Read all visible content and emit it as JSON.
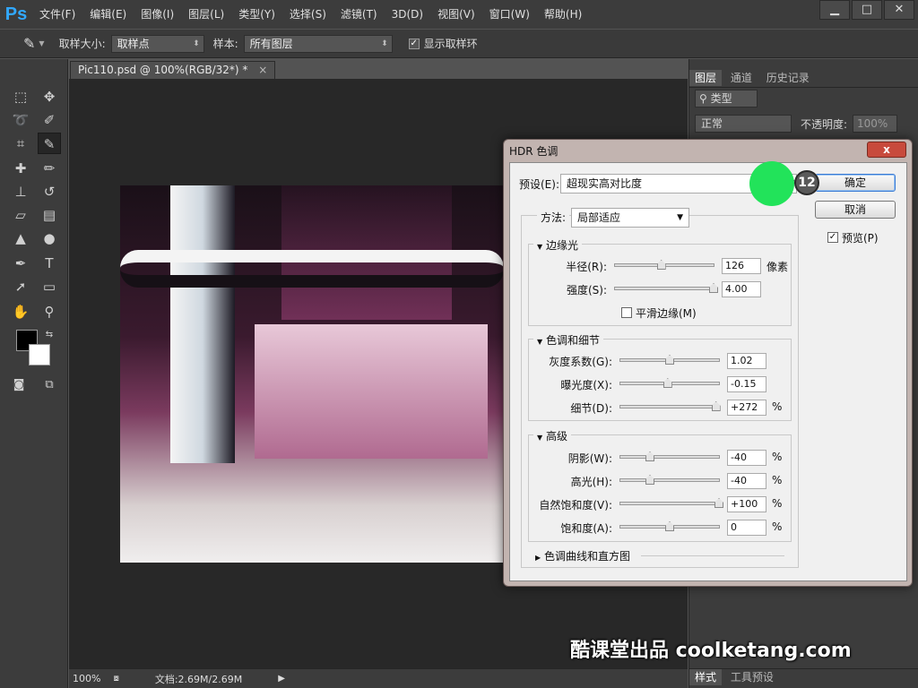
{
  "app": {
    "logo": "Ps"
  },
  "menu": [
    "文件(F)",
    "编辑(E)",
    "图像(I)",
    "图层(L)",
    "类型(Y)",
    "选择(S)",
    "滤镜(T)",
    "3D(D)",
    "视图(V)",
    "窗口(W)",
    "帮助(H)"
  ],
  "window_controls": {
    "minimize": "▁",
    "maximize": "□",
    "close": "✕"
  },
  "options": {
    "sample_size_label": "取样大小:",
    "sample_size_value": "取样点",
    "sample_label": "样本:",
    "sample_value": "所有图层",
    "show_ring_label": "显示取样环",
    "show_ring_checked": true
  },
  "document": {
    "tab_title": "Pic110.psd @ 100%(RGB/32*) *",
    "tab_close": "×",
    "zoom": "100%",
    "doc_info": "文档:2.69M/2.69M"
  },
  "panel": {
    "tabs": [
      "图层",
      "通道",
      "历史记录"
    ],
    "kind_label": "类型",
    "blend_mode": "正常",
    "opacity_label": "不透明度:",
    "opacity_value": "100%",
    "bottom_tabs": [
      "样式",
      "工具预设"
    ]
  },
  "dialog": {
    "title": "HDR 色调",
    "close_label": "x",
    "preset_label": "预设(E):",
    "preset_value": "超现实高对比度",
    "ok": "确定",
    "cancel": "取消",
    "preview_label": "预览(P)",
    "preview_checked": true,
    "method_label": "方法:",
    "method_value": "局部适应",
    "edge_glow": {
      "title": "边缘光",
      "radius_label": "半径(R):",
      "radius_value": "126",
      "radius_unit": "像素",
      "radius_level": 0.47,
      "strength_label": "强度(S):",
      "strength_value": "4.00",
      "strength_level": 1.0,
      "smooth_label": "平滑边缘(M)",
      "smooth_checked": false
    },
    "tone_detail": {
      "title": "色调和细节",
      "gamma_label": "灰度系数(G):",
      "gamma_value": "1.02",
      "gamma_level": 0.5,
      "exposure_label": "曝光度(X):",
      "exposure_value": "-0.15",
      "exposure_level": 0.48,
      "detail_label": "细节(D):",
      "detail_value": "+272",
      "detail_unit": "%",
      "detail_level": 0.97
    },
    "advanced": {
      "title": "高级",
      "shadow_label": "阴影(W):",
      "shadow_value": "-40",
      "shadow_unit": "%",
      "shadow_level": 0.3,
      "highlight_label": "高光(H):",
      "highlight_value": "-40",
      "highlight_unit": "%",
      "highlight_level": 0.3,
      "vibrance_label": "自然饱和度(V):",
      "vibrance_value": "+100",
      "vibrance_unit": "%",
      "vibrance_level": 1.0,
      "saturation_label": "饱和度(A):",
      "saturation_value": "0",
      "saturation_unit": "%",
      "saturation_level": 0.5
    },
    "curve_section": "色调曲线和直方图"
  },
  "overlay": {
    "step_number": "12",
    "watermark": "酷课堂出品 coolketang.com",
    "highlight_color": "#22e35a"
  }
}
